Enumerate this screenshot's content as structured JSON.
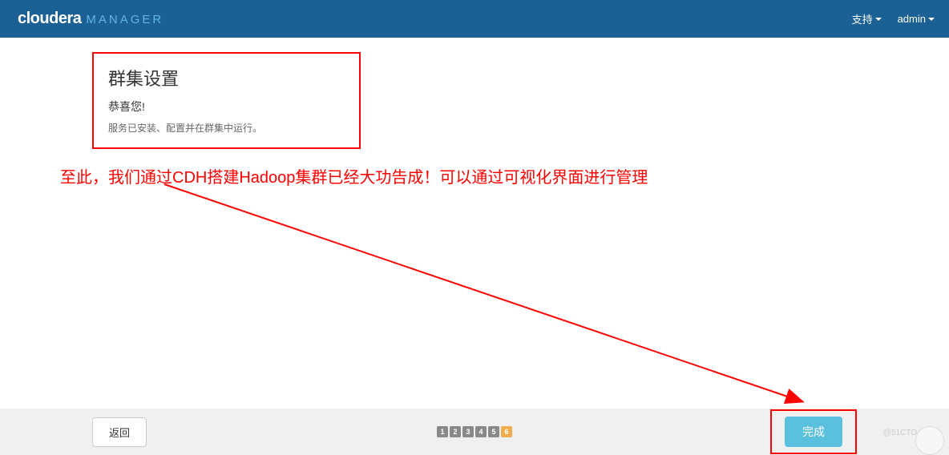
{
  "navbar": {
    "brand_main": "cloudera",
    "brand_sub": "MANAGER",
    "support_label": "支持",
    "user_label": "admin"
  },
  "setup": {
    "title": "群集设置",
    "congrat": "恭喜您!",
    "desc": "服务已安装、配置并在群集中运行。"
  },
  "annotation": {
    "text": "至此，我们通过CDH搭建Hadoop集群已经大功告成！可以通过可视化界面进行管理"
  },
  "footer": {
    "back_label": "返回",
    "finish_label": "完成",
    "steps": [
      "1",
      "2",
      "3",
      "4",
      "5",
      "6"
    ],
    "current_step": 6
  },
  "watermark": {
    "text": "@51CTO"
  }
}
